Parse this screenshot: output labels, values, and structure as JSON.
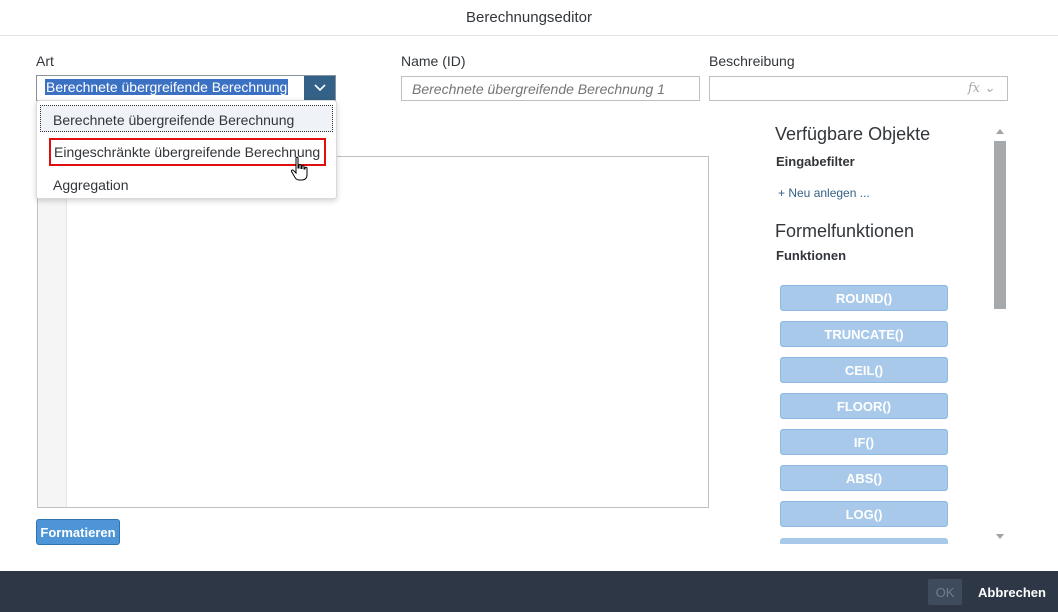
{
  "dialog": {
    "title": "Berechnungseditor"
  },
  "fields": {
    "art_label": "Art",
    "art_value": "Berechnete übergreifende Berechnung",
    "name_label": "Name (ID)",
    "name_placeholder": "Berechnete übergreifende Berechnung 1",
    "desc_label": "Beschreibung",
    "desc_icon": "fx"
  },
  "dropdown": {
    "options": [
      "Berechnete übergreifende Berechnung",
      "Eingeschränkte übergreifende Berechnung",
      "Aggregation"
    ]
  },
  "editor": {
    "format_label": "Formatieren"
  },
  "sidebar": {
    "available_objects": "Verfügbare Objekte",
    "input_filter": "Eingabefilter",
    "new_link": "+ Neu anlegen ...",
    "formula_functions": "Formelfunktionen",
    "functions": "Funktionen",
    "function_items": [
      "ROUND()",
      "TRUNCATE()",
      "CEIL()",
      "FLOOR()",
      "IF()",
      "ABS()",
      "LOG()"
    ]
  },
  "footer": {
    "ok_label": "OK",
    "cancel_label": "Abbrechen"
  },
  "colors": {
    "accent": "#346187",
    "selection": "#3b71c3",
    "highlight_border": "#e00e0e",
    "function_pill": "#a8c9e9",
    "footer_bg": "#2d3745"
  }
}
